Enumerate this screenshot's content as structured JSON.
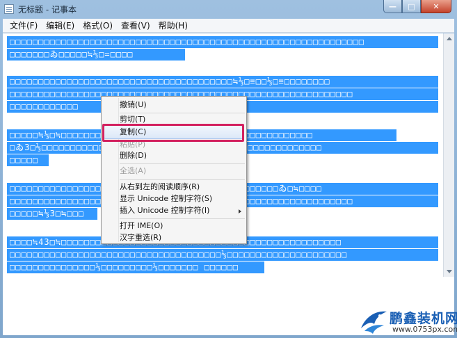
{
  "window": {
    "title": "无标题 - 记事本",
    "controls": {
      "minimize": "—",
      "maximize": "□",
      "close": "✕"
    }
  },
  "menubar": [
    {
      "label": "文件(F)"
    },
    {
      "label": "编辑(E)"
    },
    {
      "label": "格式(O)"
    },
    {
      "label": "查看(V)"
    },
    {
      "label": "帮助(H)"
    }
  ],
  "editor": {
    "lines": [
      "□□□□□□□□□□□□□□□□□□□□□□□□□□□□□□□□□□□□□□□□□□□□□□□□□□□□□□□□□□□□□□",
      "□□□□□□□ゐ□□□□□≒⅓□=□□□□",
      "□□□□□□□□□□□□□□□□□□□□□□□□□□□□□□□□□□□□□□□≒⅓□≡□□⅓□≡□□□□□□□□",
      "□□□□□□□□□□□□□□□□□□□□□□□□□□□□□□□□□□□□□□□□□□□□□□□□□□□□□□□□□□□□",
      "□□□□□□□□□□□□",
      "□□□□□≒⅓□≒□□□□□□□□□□□□□□□□□□□□□□□□□□□□□□□□□□□□□□□□□□□□",
      "□ゐ3□⅓□□□□□□□□□□□□□□□□□□□□□□□□□□□□□□□□□□□□□□□□□□□□□□□□□",
      "□□□□□",
      "□□□□□□□□□□□□□□□□□□□□□□□□□□□□□□≒□□□□□□□□□□□□□□□□ゐ□≒□□□□",
      "□□□□□□□□□□□□□□□□□□□□□□□□□□□□□□□□□□□□□□□□□□□□□□□□□□□□□□□□□□□□",
      "□□□□□≒⅓3□≒□□□",
      "□□□□≒43□≒□□□□□□□□□□□□□□□□□□□□□□□□□□□□□□□□□□□□□□□□□□□□□□□□□",
      "□□□□□□□□□□□□□□□□□□□□□□□□□□□□□□□□□□□□□⅓□□□□□□□□□□□□□□□□□□□□□",
      "□□□□□□□□□□□□□□□⅓□□□□□□□□□⅓□□□□□□□ □□□□□□"
    ]
  },
  "context_menu": {
    "items": [
      {
        "label": "撤销(U)",
        "disabled": false
      },
      {
        "label": "剪切(T)",
        "disabled": false
      },
      {
        "label": "复制(C)",
        "disabled": false,
        "highlighted": true
      },
      {
        "label": "粘贴(P)",
        "disabled": true
      },
      {
        "label": "删除(D)",
        "disabled": false
      },
      {
        "label": "全选(A)",
        "disabled": true
      },
      {
        "label": "从右到左的阅读顺序(R)",
        "disabled": false
      },
      {
        "label": "显示 Unicode 控制字符(S)",
        "disabled": false
      },
      {
        "label": "插入 Unicode 控制字符(I)",
        "disabled": false,
        "submenu": true
      },
      {
        "label": "打开 IME(O)",
        "disabled": false
      },
      {
        "label": "汉字重选(R)",
        "disabled": false
      }
    ]
  },
  "watermark": {
    "title": "鹏鑫装机网",
    "url": "www.0753px.com"
  },
  "colors": {
    "selection": "#3399ff",
    "highlight_box": "#d3215f"
  }
}
